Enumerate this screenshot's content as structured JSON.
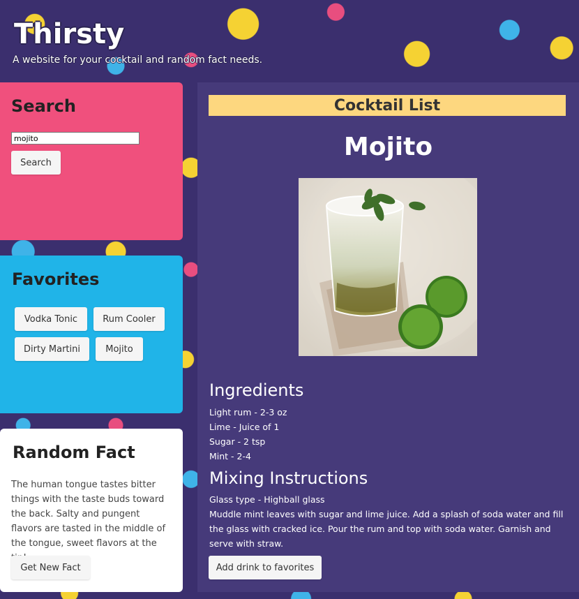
{
  "header": {
    "title": "Thirsty",
    "tagline": "A website for your cocktail and random fact needs."
  },
  "search": {
    "heading": "Search",
    "input_value": "mojito",
    "button_label": "Search"
  },
  "favorites": {
    "heading": "Favorites",
    "items": [
      {
        "label": "Vodka Tonic"
      },
      {
        "label": "Rum Cooler"
      },
      {
        "label": "Dirty Martini"
      },
      {
        "label": "Mojito"
      }
    ]
  },
  "random_fact": {
    "heading": "Random Fact",
    "text": "The human tongue tastes bitter things with the taste buds toward the back. Salty and pungent flavors are tasted in the middle of the tongue, sweet flavors at the tip!",
    "button_label": "Get New Fact"
  },
  "main": {
    "heading": "Cocktail List",
    "drink_name": "Mojito",
    "ingredients_title": "Ingredients",
    "ingredients": [
      "Light rum - 2-3 oz",
      "Lime - Juice of 1",
      "Sugar - 2 tsp",
      "Mint - 2-4"
    ],
    "mixing_title": "Mixing Instructions",
    "glass_type": "Glass type - Highball glass",
    "instructions": "Muddle mint leaves with sugar and lime juice. Add a splash of soda water and fill the glass with cracked ice. Pour the rum and top with soda water. Garnish and serve with straw.",
    "add_favorite_label": "Add drink to favorites"
  },
  "colors": {
    "background": "#3b2f6e",
    "search_panel": "#f0507d",
    "favorites_panel": "#20b4e8",
    "main_panel": "#463a7a",
    "main_heading_bar": "#fdd77f"
  }
}
